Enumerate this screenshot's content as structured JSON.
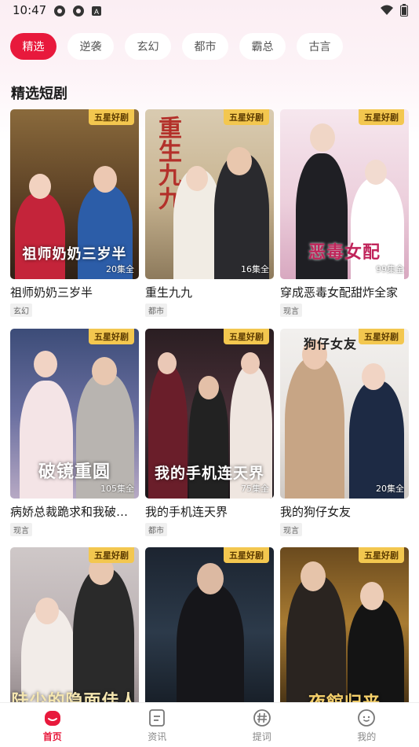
{
  "status_bar": {
    "time": "10:47",
    "left_icons": [
      "settings-icon",
      "settings-icon",
      "font-icon"
    ],
    "right_icons": [
      "wifi-icon",
      "battery-icon"
    ]
  },
  "tabs": [
    {
      "label": "精选",
      "active": true
    },
    {
      "label": "逆袭",
      "active": false
    },
    {
      "label": "玄幻",
      "active": false
    },
    {
      "label": "都市",
      "active": false
    },
    {
      "label": "霸总",
      "active": false
    },
    {
      "label": "古言",
      "active": false
    }
  ],
  "section_title": "精选短剧",
  "dramas": [
    {
      "title": "祖师奶奶三岁半",
      "tag": "玄幻",
      "badge": "五星好剧",
      "episodes": "20集全",
      "poster_text": "祖师奶奶三岁半"
    },
    {
      "title": "重生九九",
      "tag": "都市",
      "badge": "五星好剧",
      "episodes": "16集全",
      "poster_text": "重生九九"
    },
    {
      "title": "穿成恶毒女配甜炸全家",
      "tag": "现言",
      "badge": "五星好剧",
      "episodes": "99集全",
      "poster_text": "恶毒女配"
    },
    {
      "title": "病娇总裁跪求和我破…",
      "tag": "现言",
      "badge": "五星好剧",
      "episodes": "105集全",
      "poster_text": "破镜重圆"
    },
    {
      "title": "我的手机连天界",
      "tag": "都市",
      "badge": "五星好剧",
      "episodes": "75集全",
      "poster_text": "我的手机连天界"
    },
    {
      "title": "我的狗仔女友",
      "tag": "现言",
      "badge": "五星好剧",
      "episodes": "20集全",
      "poster_text": "狗仔女友"
    },
    {
      "title": "",
      "tag": "",
      "badge": "五星好剧",
      "episodes": "",
      "poster_text": "陆少的隐面佳人"
    },
    {
      "title": "",
      "tag": "",
      "badge": "五星好剧",
      "episodes": "",
      "poster_text": ""
    },
    {
      "title": "",
      "tag": "",
      "badge": "五星好剧",
      "episodes": "",
      "poster_text": "夜館归来"
    }
  ],
  "bottom_nav": [
    {
      "label": "首页",
      "icon": "home-icon",
      "active": true
    },
    {
      "label": "资讯",
      "icon": "news-icon",
      "active": false
    },
    {
      "label": "提词",
      "icon": "hashtag-icon",
      "active": false
    },
    {
      "label": "我的",
      "icon": "profile-icon",
      "active": false
    }
  ],
  "colors": {
    "accent": "#e8193c",
    "badge": "#f3c74f"
  }
}
